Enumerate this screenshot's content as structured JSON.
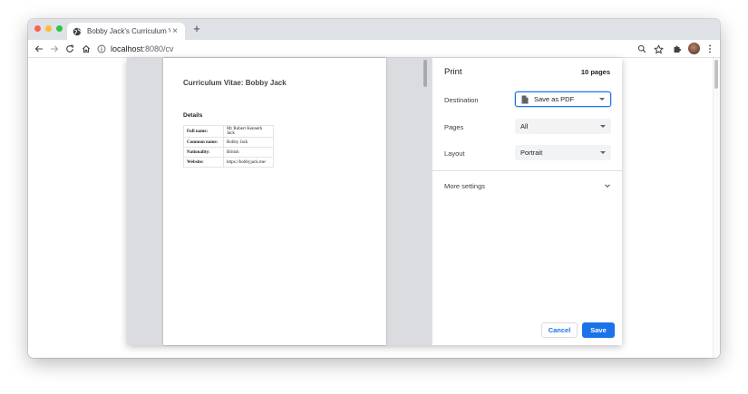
{
  "browser": {
    "tab": {
      "title": "Bobby Jack's Curriculum Vitae",
      "close_glyph": "×",
      "favicon": "globe-icon"
    },
    "new_tab_glyph": "+",
    "url": {
      "host": "localhost",
      "path": ":8080/cv"
    },
    "icons": [
      "back-arrow-icon",
      "forward-arrow-icon",
      "reload-icon",
      "home-icon",
      "info-icon",
      "zoom-icon",
      "star-icon",
      "puzzle-icon",
      "avatar",
      "kebab-menu-icon"
    ]
  },
  "document": {
    "title": "Curriculum Vitae: Bobby Jack",
    "section": "Details",
    "rows": [
      {
        "key": "Full name:",
        "value": "Mr Robert Kenneth Jack"
      },
      {
        "key": "Common name:",
        "value": "Bobby Jack"
      },
      {
        "key": "Nationality:",
        "value": "British"
      },
      {
        "key": "Website:",
        "value": "https://bobbyjack.me/"
      }
    ]
  },
  "print": {
    "title": "Print",
    "page_count": "10 pages",
    "destination": {
      "label": "Destination",
      "value": "Save as PDF"
    },
    "pages": {
      "label": "Pages",
      "value": "All"
    },
    "layout": {
      "label": "Layout",
      "value": "Portrait"
    },
    "more_settings": "More settings",
    "cancel_label": "Cancel",
    "save_label": "Save"
  },
  "colors": {
    "accent": "#1a73e8",
    "tab_strip": "#dee1e6",
    "preview_bg": "#dadce0"
  }
}
